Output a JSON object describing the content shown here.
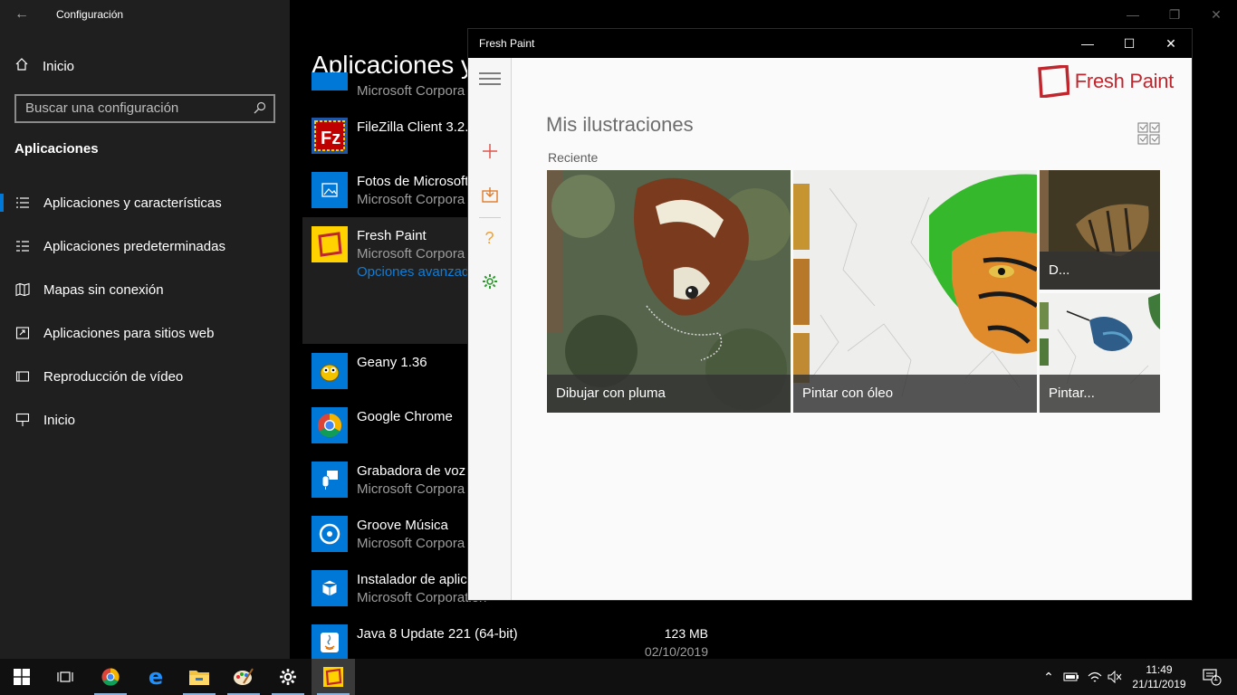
{
  "settings": {
    "title": "Configuración",
    "back_icon": "back-arrow-icon",
    "home_label": "Inicio",
    "search_placeholder": "Buscar una configuración",
    "section": "Aplicaciones",
    "nav": [
      {
        "label": "Aplicaciones y características",
        "icon": "apps-list-icon",
        "active": true
      },
      {
        "label": "Aplicaciones predeterminadas",
        "icon": "default-apps-icon"
      },
      {
        "label": "Mapas sin conexión",
        "icon": "map-icon"
      },
      {
        "label": "Aplicaciones para sitios web",
        "icon": "website-app-icon"
      },
      {
        "label": "Reproducción de vídeo",
        "icon": "video-icon"
      },
      {
        "label": "Inicio",
        "icon": "startup-icon"
      }
    ],
    "heading": "Aplicaciones y",
    "apps": [
      {
        "name": "",
        "publisher": "Microsoft Corpora"
      },
      {
        "name": "FileZilla Client 3.2.8",
        "publisher": ""
      },
      {
        "name": "Fotos de Microsoft",
        "publisher": "Microsoft Corpora"
      },
      {
        "name": "Fresh Paint",
        "publisher": "Microsoft Corpora",
        "link": "Opciones avanzada"
      },
      {
        "name": "Geany 1.36",
        "publisher": ""
      },
      {
        "name": "Google Chrome",
        "publisher": ""
      },
      {
        "name": "Grabadora de voz",
        "publisher": "Microsoft Corpora"
      },
      {
        "name": "Groove Música",
        "publisher": "Microsoft Corpora"
      },
      {
        "name": "Instalador de aplic",
        "publisher": "Microsoft Corporation"
      },
      {
        "name": "Java 8 Update 221 (64-bit)",
        "publisher": "",
        "size": "123 MB",
        "date": "02/10/2019"
      }
    ]
  },
  "freshpaint": {
    "title": "Fresh Paint",
    "logo": "Fresh Paint",
    "heading": "Mis ilustraciones",
    "recent_label": "Reciente",
    "rail": [
      "menu-icon",
      "new-icon",
      "import-icon",
      "help-icon",
      "settings-icon"
    ],
    "tiles": [
      {
        "caption": "Dibujar con pluma"
      },
      {
        "caption": "Pintar con óleo"
      },
      {
        "caption": "D..."
      },
      {
        "caption": "Pintar..."
      }
    ],
    "colors": {
      "accent": "#c0262d",
      "green": "#2d9a2d",
      "orange": "#e07b2a"
    }
  },
  "taskbar": {
    "apps": [
      "windows-start-icon",
      "task-view-icon",
      "chrome-icon",
      "edge-icon",
      "file-explorer-icon",
      "paint-icon",
      "settings-icon",
      "fresh-paint-icon"
    ],
    "time": "11:49",
    "date": "21/11/2019",
    "notifications": "1"
  }
}
